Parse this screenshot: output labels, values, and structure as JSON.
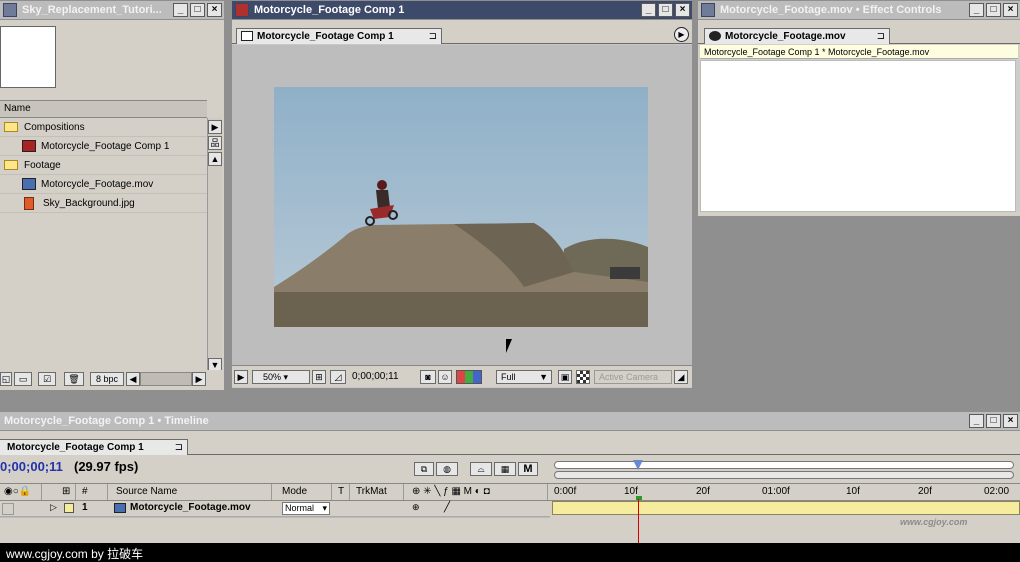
{
  "project": {
    "title": "Sky_Replacement_Tutori...",
    "column_name": "Name",
    "items": [
      {
        "label": "Compositions",
        "kind": "folder"
      },
      {
        "label": "Motorcycle_Footage Comp 1",
        "kind": "comp"
      },
      {
        "label": "Footage",
        "kind": "folder"
      },
      {
        "label": "Motorcycle_Footage.mov",
        "kind": "movie"
      },
      {
        "label": "Sky_Background.jpg",
        "kind": "image"
      }
    ],
    "bpc": "8 bpc"
  },
  "comp": {
    "window_title": "Motorcycle_Footage Comp 1",
    "tab_label": "Motorcycle_Footage Comp 1",
    "zoom": "50%",
    "timecode": "0;00;00;11",
    "resolution": "Full",
    "camera": "Active Camera"
  },
  "effects": {
    "window_title": "Motorcycle_Footage.mov • Effect Controls",
    "tab_label": "Motorcycle_Footage.mov",
    "path": "Motorcycle_Footage Comp 1 * Motorcycle_Footage.mov"
  },
  "timeline": {
    "window_title": "Motorcycle_Footage Comp 1 • Timeline",
    "tab_label": "Motorcycle_Footage Comp 1",
    "timecode": "0;00;00;11",
    "fps": "(29.97 fps)",
    "columns": {
      "hash": "#",
      "source": "Source Name",
      "mode": "Mode",
      "t": "T",
      "trkmat": "TrkMat"
    },
    "ruler": [
      "0:00f",
      "10f",
      "20f",
      "01:00f",
      "10f",
      "20f",
      "02:00"
    ],
    "layers": [
      {
        "num": "1",
        "name": "Motorcycle_Footage.mov",
        "mode": "Normal"
      }
    ]
  },
  "watermark": {
    "url": "www.cgjoy.com",
    "text": "www.cgjoy.com by 拉破车"
  },
  "colors": {
    "label_yellow": "#f6ec9e",
    "playhead": "#d40000",
    "sky": "#9fb8cc"
  }
}
